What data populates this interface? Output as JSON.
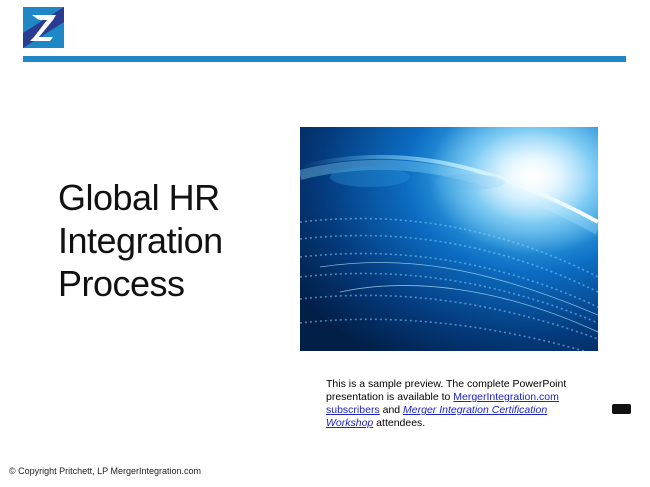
{
  "slide": {
    "title_lines": [
      "Global HR",
      "Integration",
      "Process"
    ],
    "note": {
      "text1": "This is a sample preview. The complete PowerPoint presentation is available to ",
      "link1": "MergerIntegration.com subscribers",
      "text2": " and ",
      "link2": "Merger Integration Certification Workshop",
      "text3": " attendees."
    },
    "footer": "© Copyright Pritchett, LP   MergerIntegration.com"
  },
  "colors": {
    "accent_rule": "#1f87c6",
    "logo_blue": "#2b3b8f",
    "link": "#1a24c8"
  },
  "icons": {
    "logo": "brand-logo-icon",
    "chip": "keyboard-chip-icon"
  }
}
